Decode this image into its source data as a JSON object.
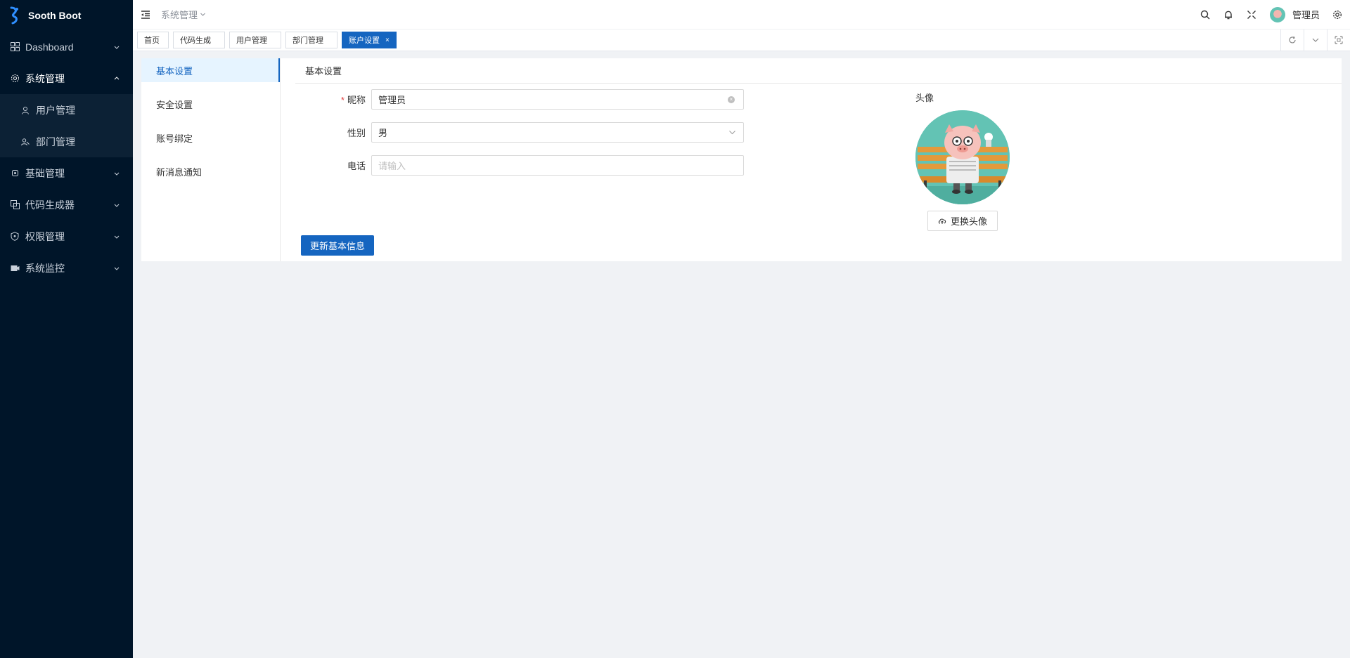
{
  "app": {
    "title": "Sooth Boot"
  },
  "sidebar": {
    "items": [
      {
        "label": "Dashboard",
        "icon": "dashboard-icon"
      },
      {
        "label": "系统管理",
        "icon": "gear-icon",
        "open": true,
        "children": [
          {
            "label": "用户管理",
            "icon": "user-icon"
          },
          {
            "label": "部门管理",
            "icon": "department-icon"
          }
        ]
      },
      {
        "label": "基础管理",
        "icon": "basic-icon"
      },
      {
        "label": "代码生成器",
        "icon": "code-icon"
      },
      {
        "label": "权限管理",
        "icon": "shield-icon"
      },
      {
        "label": "系统监控",
        "icon": "monitor-icon"
      }
    ]
  },
  "header": {
    "breadcrumb": "系统管理",
    "user_name": "管理员"
  },
  "tabs": [
    {
      "label": "首页"
    },
    {
      "label": "代码生成"
    },
    {
      "label": "用户管理"
    },
    {
      "label": "部门管理"
    },
    {
      "label": "账户设置",
      "active": true,
      "close": "×"
    }
  ],
  "settings_nav": [
    {
      "label": "基本设置",
      "active": true
    },
    {
      "label": "安全设置"
    },
    {
      "label": "账号绑定"
    },
    {
      "label": "新消息通知"
    }
  ],
  "basic_settings": {
    "title": "基本设置",
    "nickname": {
      "label": "昵称",
      "required_mark": "*",
      "value": "管理员"
    },
    "gender": {
      "label": "性别",
      "value": "男"
    },
    "phone": {
      "label": "电话",
      "placeholder": "请输入"
    },
    "submit_label": "更新基本信息",
    "avatar_label": "头像",
    "change_avatar_label": "更换头像"
  },
  "colors": {
    "sidebar_bg": "#001529",
    "accent": "#1565c0",
    "required": "#e03e3e"
  }
}
